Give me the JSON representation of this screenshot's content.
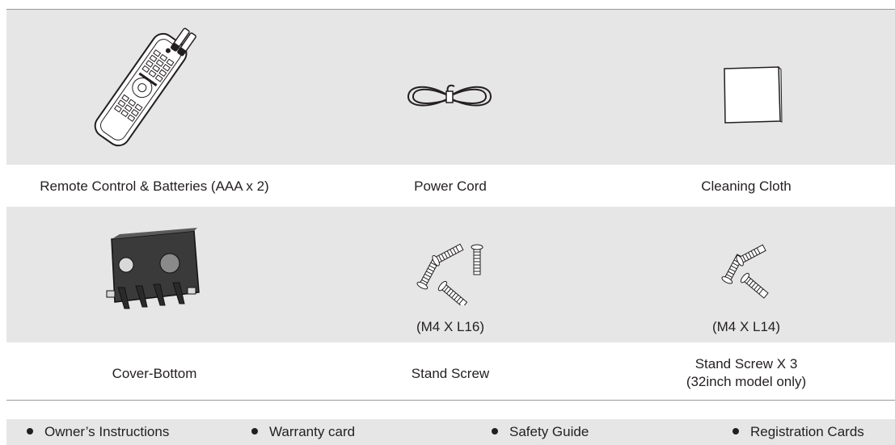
{
  "row1": {
    "items": [
      {
        "label": "Remote Control & Batteries (AAA x 2)",
        "icon": "remote-control-icon"
      },
      {
        "label": "Power Cord",
        "icon": "power-cord-icon"
      },
      {
        "label": "Cleaning Cloth",
        "icon": "cleaning-cloth-icon"
      }
    ]
  },
  "row2": {
    "items": [
      {
        "label": "Cover-Bottom",
        "spec": "",
        "icon": "cover-bottom-icon"
      },
      {
        "label": "Stand Screw",
        "spec": "(M4 X L16)",
        "icon": "stand-screw-icon"
      },
      {
        "label_line1": "Stand Screw X 3",
        "label_line2": "(32inch model only)",
        "spec": "(M4 X L14)",
        "icon": "stand-screw-x3-icon"
      }
    ]
  },
  "documents": [
    "Owner’s Instructions",
    "Warranty card",
    "Safety Guide",
    "Registration Cards"
  ],
  "colors": {
    "panel_background": "#e6e6e6",
    "rule": "#9a9a9a",
    "text": "#231f20"
  }
}
